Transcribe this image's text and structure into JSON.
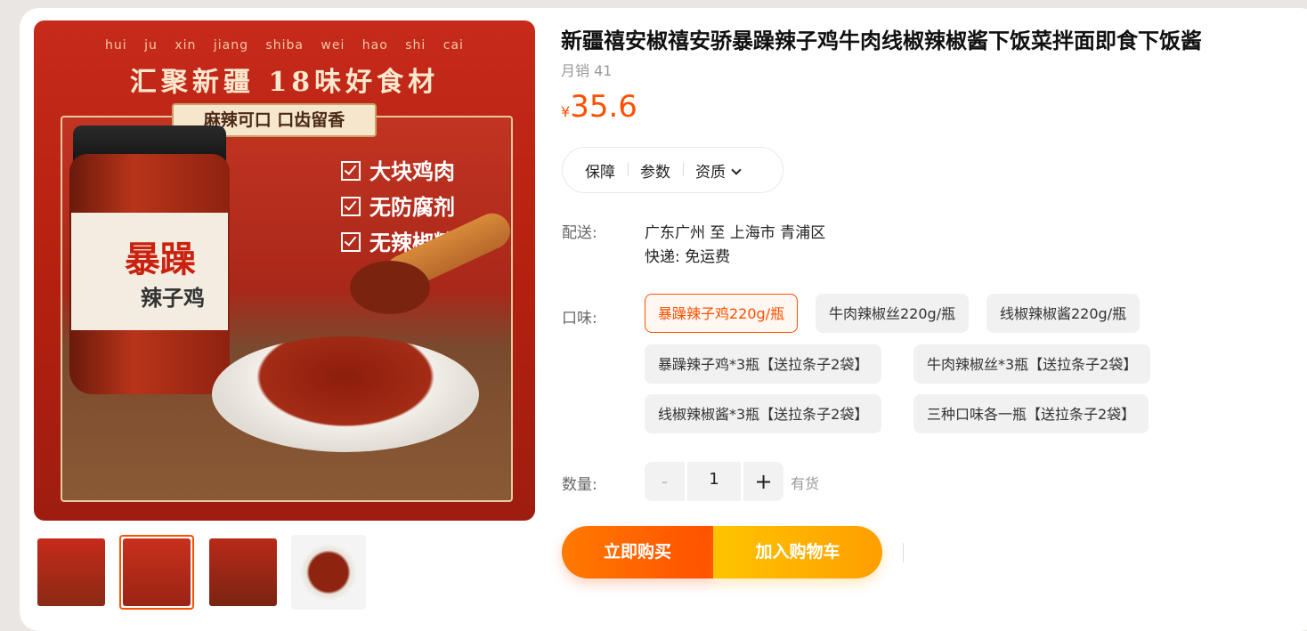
{
  "product": {
    "title": "新疆禧安椒禧安骄暴躁辣子鸡牛肉线椒辣椒酱下饭菜拌面即食下饭酱",
    "sales": "月销 41",
    "currency": "¥",
    "price": "35.6"
  },
  "image": {
    "pinyin": "hui ju xin jiang shiba wei hao shi cai",
    "headline": "汇聚新疆  18味好食材",
    "banner": "麻辣可口 口齿留香",
    "features": [
      "大块鸡肉",
      "无防腐剂",
      "无辣椒精"
    ],
    "jar_label_big": "暴躁",
    "jar_label_small": "辣子鸡"
  },
  "tabs": [
    "保障",
    "参数",
    "资质"
  ],
  "shipping": {
    "label": "配送:",
    "route": "广东广州 至 上海市 青浦区",
    "method": "快递: 免运费"
  },
  "flavor": {
    "label": "口味:",
    "options": [
      "暴躁辣子鸡220g/瓶",
      "牛肉辣椒丝220g/瓶",
      "线椒辣椒酱220g/瓶",
      "暴躁辣子鸡*3瓶【送拉条子2袋】",
      "牛肉辣椒丝*3瓶【送拉条子2袋】",
      "线椒辣椒酱*3瓶【送拉条子2袋】",
      "三种口味各一瓶【送拉条子2袋】"
    ],
    "selected_index": 0
  },
  "quantity": {
    "label": "数量:",
    "minus": "-",
    "value": "1",
    "plus": "+",
    "stock": "有货"
  },
  "actions": {
    "buy_now": "立即购买",
    "add_cart": "加入购物车"
  },
  "colors": {
    "accent": "#ff5000",
    "cart": "#ffb000"
  }
}
